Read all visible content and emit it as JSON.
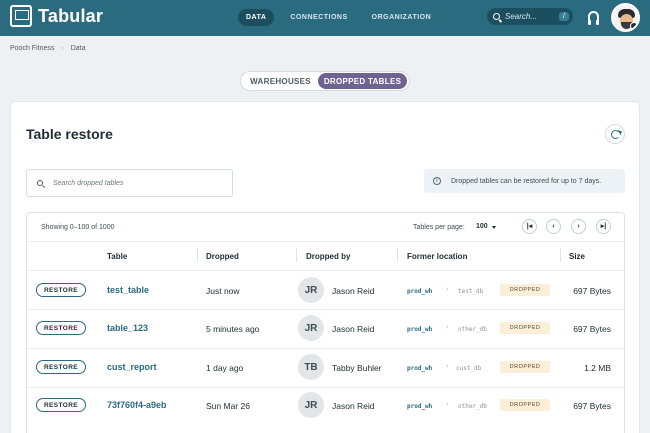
{
  "app": {
    "name": "Tabular"
  },
  "nav": {
    "tabs": [
      "DATA",
      "CONNECTIONS",
      "ORGANIZATION"
    ],
    "active": "DATA"
  },
  "search": {
    "placeholder": "Search...",
    "shortcut": "/"
  },
  "breadcrumb": [
    "Pooch Fitness",
    "Data"
  ],
  "segment": {
    "options": [
      "WAREHOUSES",
      "DROPPED TABLES"
    ],
    "selected": "DROPPED TABLES"
  },
  "page": {
    "title": "Table restore",
    "search_placeholder": "Search dropped tables",
    "info": "Dropped tables can be restored for up to 7 days."
  },
  "pagination": {
    "showing": "Showing 0–100 of 1000",
    "per_page_label": "Tables per page:",
    "per_page_value": "100",
    "first": "|◂",
    "prev": "‹",
    "next": "›",
    "last": "▸|"
  },
  "table": {
    "columns": [
      "Table",
      "Dropped",
      "Dropped by",
      "Former location",
      "Size"
    ],
    "action_label": "RESTORE",
    "status_label": "DROPPED",
    "rows": [
      {
        "name": "test_table",
        "dropped": "Just now",
        "initials": "JR",
        "by": "Jason Reid",
        "warehouse": "prod_wh",
        "db": "test_db",
        "size": "697 Bytes"
      },
      {
        "name": "table_123",
        "dropped": "5 minutes ago",
        "initials": "JR",
        "by": "Jason Reid",
        "warehouse": "prod_wh",
        "db": "other_db",
        "size": "697 Bytes"
      },
      {
        "name": "cust_report",
        "dropped": "1 day ago",
        "initials": "TB",
        "by": "Tabby Buhler",
        "warehouse": "prod_wh",
        "db": "cust_db",
        "size": "1.2 MB"
      },
      {
        "name": "73f760f4-a9eb",
        "dropped": "Sun Mar 26",
        "initials": "JR",
        "by": "Jason Reid",
        "warehouse": "prod_wh",
        "db": "other_db",
        "size": "697 Bytes"
      }
    ]
  },
  "colors": {
    "header": "#2a6b80",
    "accent_purple": "#6e6392",
    "badge_bg": "#fbefd9",
    "link": "#2a6b80"
  },
  "icons": {
    "logo": "table-logo-icon",
    "search": "search-icon",
    "support": "headset-icon",
    "refresh": "refresh-icon",
    "info": "info-icon"
  }
}
